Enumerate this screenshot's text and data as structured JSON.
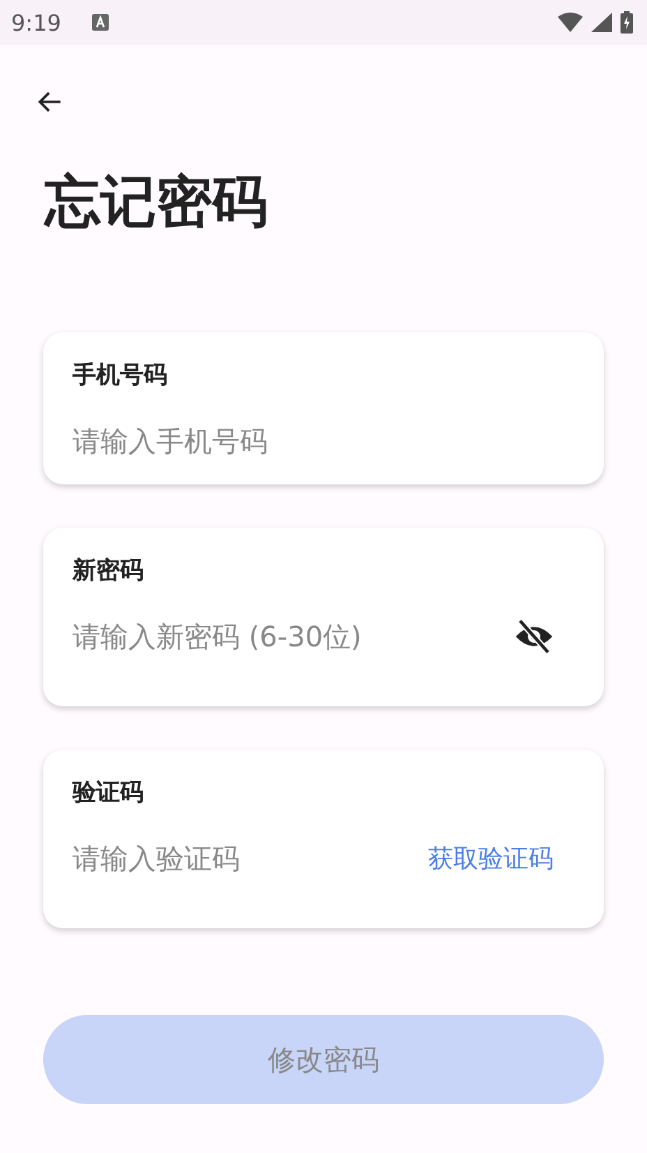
{
  "status_bar": {
    "time": "9:19"
  },
  "title": "忘记密码",
  "fields": [
    {
      "kind": "plain",
      "label": "手机号码",
      "placeholder": "请输入手机号码"
    },
    {
      "kind": "password",
      "label": "新密码",
      "placeholder": "请输入新密码 (6-30位)",
      "visible": false
    },
    {
      "kind": "code",
      "label": "验证码",
      "placeholder": "请输入验证码",
      "action": "获取验证码"
    }
  ],
  "submit": {
    "label": "修改密码",
    "disabled": true
  }
}
